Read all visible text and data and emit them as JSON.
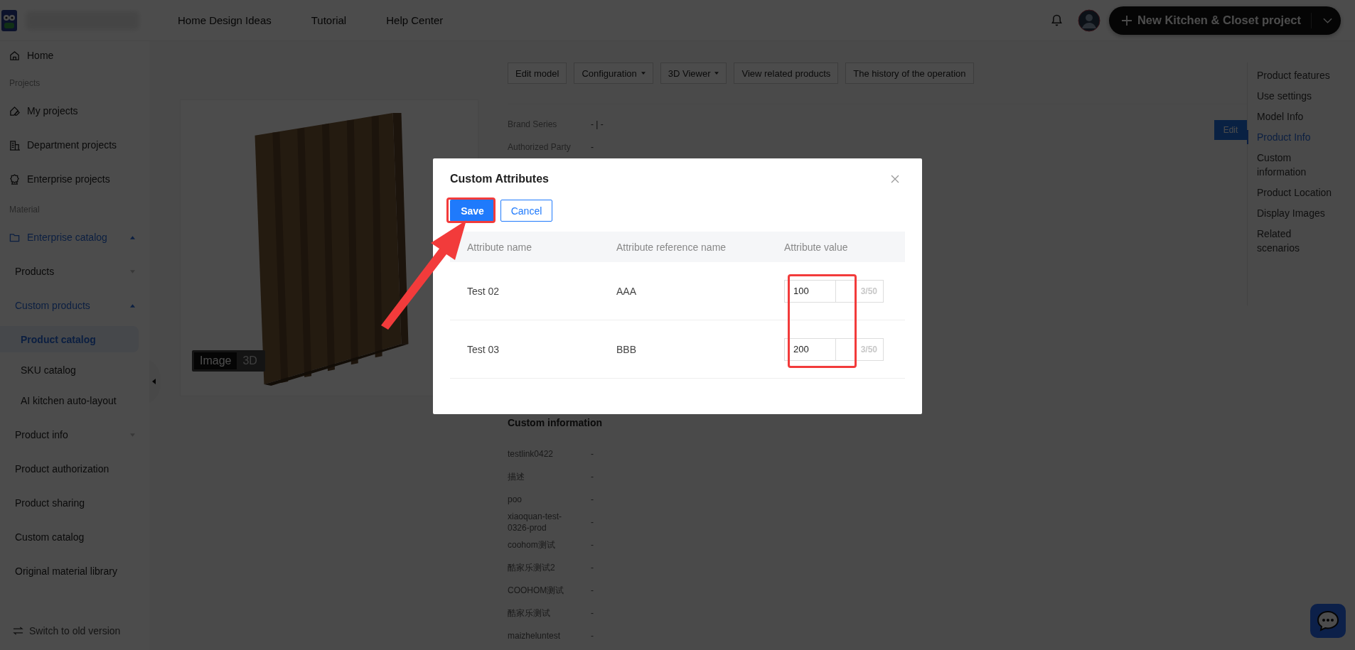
{
  "top_bar": {
    "links": [
      {
        "label": "Home Design Ideas"
      },
      {
        "label": "Tutorial"
      },
      {
        "label": "Help Center"
      }
    ],
    "new_project_button": "New Kitchen & Closet project"
  },
  "sidebar": {
    "items": [
      {
        "kind": "link",
        "label": "Home"
      },
      {
        "kind": "heading",
        "label": "Projects"
      },
      {
        "kind": "link",
        "label": "My projects"
      },
      {
        "kind": "link",
        "label": "Department projects"
      },
      {
        "kind": "link",
        "label": "Enterprise projects"
      },
      {
        "kind": "heading",
        "label": "Material"
      },
      {
        "kind": "folder",
        "label": "Enterprise catalog",
        "expanded": true,
        "children": [
          {
            "label": "Products",
            "expanded": false
          },
          {
            "label": "Custom products",
            "expanded": true,
            "children": [
              {
                "label": "Product catalog",
                "selected": true
              },
              {
                "label": "SKU catalog",
                "selected": false
              },
              {
                "label": "AI kitchen auto-layout",
                "selected": false
              }
            ]
          },
          {
            "label": "Product info",
            "expanded": false
          },
          {
            "label": "Product authorization"
          },
          {
            "label": "Product sharing"
          },
          {
            "label": "Custom catalog"
          },
          {
            "label": "Original material library"
          }
        ]
      }
    ],
    "footer": "Switch to old version"
  },
  "product_toolbar": [
    {
      "label": "Edit model",
      "dropdown": false
    },
    {
      "label": "Configuration",
      "dropdown": true
    },
    {
      "label": "3D Viewer",
      "dropdown": true
    },
    {
      "label": "View related products",
      "dropdown": false
    },
    {
      "label": "The history of the operation",
      "dropdown": false
    }
  ],
  "image_viewer": {
    "modes": [
      {
        "label": "Image",
        "selected": true
      },
      {
        "label": "3D",
        "selected": false
      }
    ]
  },
  "product_info": {
    "rows": [
      {
        "label": "Brand Series",
        "value": "- | -"
      },
      {
        "label": "Authorized Party",
        "value": "-"
      }
    ],
    "edit_button": "Edit"
  },
  "custom_information": {
    "title": "Custom information",
    "rows": [
      {
        "label": "testlink0422",
        "value": "-"
      },
      {
        "label": "描述",
        "value": "-"
      },
      {
        "label": "poo",
        "value": "-"
      },
      {
        "label": "xiaoquan-test-0326-prod",
        "value": "-"
      },
      {
        "label": "coohom测试",
        "value": "-"
      },
      {
        "label": "酷家乐测试2",
        "value": "-"
      },
      {
        "label": "COOHOM测试",
        "value": "-"
      },
      {
        "label": "酷家乐测试",
        "value": "-"
      },
      {
        "label": "maizheluntest",
        "value": "-"
      }
    ]
  },
  "right_nav": [
    {
      "label": "Product features",
      "selected": false
    },
    {
      "label": "Use settings",
      "selected": false
    },
    {
      "label": "Model Info",
      "selected": false
    },
    {
      "label": "Product Info",
      "selected": true
    },
    {
      "label": "Custom information",
      "selected": false
    },
    {
      "label": "Product Location",
      "selected": false
    },
    {
      "label": "Display Images",
      "selected": false
    },
    {
      "label": "Related scenarios",
      "selected": false
    }
  ],
  "dialog": {
    "title": "Custom Attributes",
    "save_button": "Save",
    "cancel_button": "Cancel",
    "columns": [
      "Attribute name",
      "Attribute reference name",
      "Attribute value"
    ],
    "rows": [
      {
        "name": "Test 02",
        "reference": "AAA",
        "value": "100",
        "counter": "3/50"
      },
      {
        "name": "Test 03",
        "reference": "BBB",
        "value": "200",
        "counter": "3/50"
      }
    ]
  }
}
